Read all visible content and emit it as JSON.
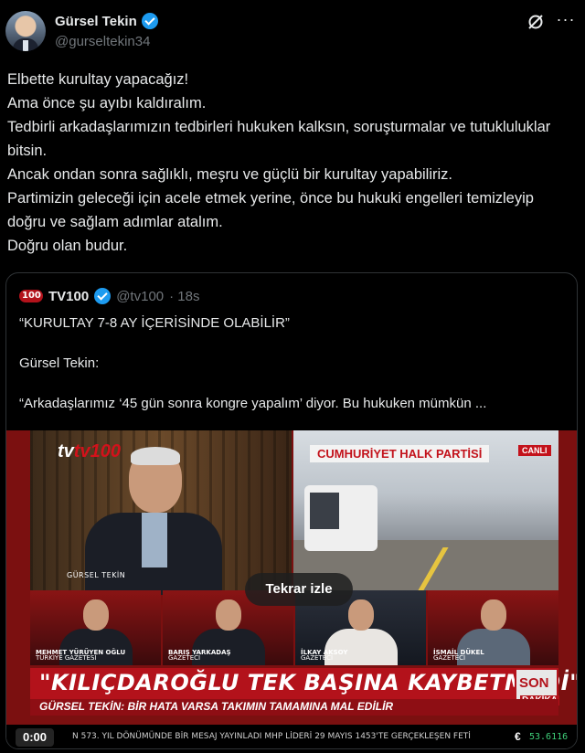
{
  "author": {
    "display_name": "Gürsel Tekin",
    "handle": "@gurseltekin34",
    "verified": true
  },
  "icons": [
    "verified-badge-icon",
    "grok-icon",
    "more-options-icon",
    "tv100-logo-icon"
  ],
  "post": {
    "lines": [
      "Elbette kurultay yapacağız!",
      "Ama önce şu ayıbı kaldıralım.",
      "Tedbirli arkadaşlarımızın tedbirleri hukuken kalksın, soruşturmalar ve tutukluluklar bitsin.",
      "Ancak ondan sonra sağlıklı, meşru ve güçlü bir kurultay yapabiliriz.",
      "Partimizin geleceği için acele etmek yerine, önce bu hukuki engelleri temizleyip doğru ve sağlam adımlar atalım.",
      "Doğru olan budur."
    ]
  },
  "quote": {
    "name": "TV100",
    "handle": "@tv100",
    "time": "· 18s",
    "line1": "“KURULTAY 7-8 AY İÇERİSİNDE OLABİLİR”",
    "line2": "Gürsel Tekin:",
    "line3": "“Arkadaşlarımız ‘45 gün sonra kongre yapalım’ diyor. Bu hukuken mümkün ...",
    "video": {
      "replay_label": "Tekrar izle",
      "timecode": "0:00",
      "tv_bug": "tv100",
      "lower_name": "GÜRSEL TEKİN",
      "party_sign": "CUMHURİYET HALK PARTİSİ",
      "live_badge": "CANLI",
      "panelists": [
        {
          "name": "MEHMET YÜRÜYEN OĞLU",
          "role": "TÜRKİYE GAZETESİ"
        },
        {
          "name": "BARIŞ YARKADAŞ",
          "role": "GAZETECİ"
        },
        {
          "name": "İLKAY AKSOY",
          "role": "GAZETECİ"
        },
        {
          "name": "İSMAİL DÜKEL",
          "role": "GAZETECİ"
        }
      ],
      "headline": "\"KILIÇDAROĞLU TEK BAŞINA KAYBETMEDİ\"",
      "subline": "GÜRSEL TEKİN: BİR HATA VARSA TAKIMIN TAMAMINA MAL EDİLİR",
      "son_dakika_1": "SON",
      "son_dakika_2": "DAKİKA",
      "ticker": "N 573. YIL DÖNÜMÜNDE BİR MESAJ YAYINLADI   MHP LİDERİ 29 MAYIS 1453'TE GERÇEKLEŞEN FETİ",
      "euro_symbol": "€",
      "euro_value": "53.6116"
    }
  }
}
